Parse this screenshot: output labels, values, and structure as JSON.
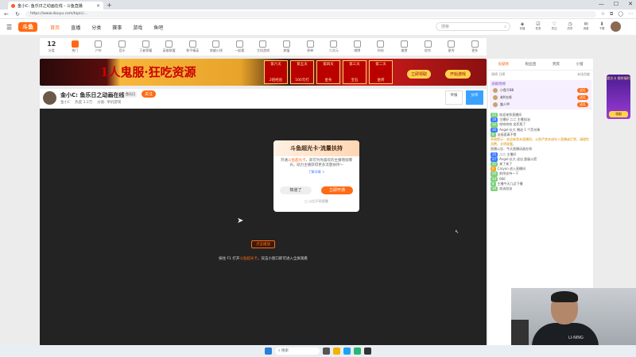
{
  "browser": {
    "tab_title": "金小C: 鱼乐日之动画在线 - 斗鱼直播",
    "new_tab": "+",
    "url": "https://www.douyu.com/topic/..."
  },
  "site": {
    "logo": "斗鱼",
    "nav": [
      "首页",
      "直播",
      "分类",
      "赛事",
      "游戏",
      "鱼吧"
    ],
    "search_placeholder": "搜索",
    "header_icons": [
      {
        "name": "recharge-icon",
        "label": "充值"
      },
      {
        "name": "task-icon",
        "label": "任务"
      },
      {
        "name": "follow-icon",
        "label": "关注"
      },
      {
        "name": "history-icon",
        "label": "历史"
      },
      {
        "name": "message-icon",
        "label": "消息"
      },
      {
        "name": "download-icon",
        "label": "下载"
      },
      {
        "name": "live-icon",
        "label": "开播"
      }
    ]
  },
  "categories": {
    "first_num": "12",
    "first_label": "分类",
    "items": [
      "热门",
      "户外",
      "音乐",
      "王者荣耀",
      "英雄联盟",
      "和平精英",
      "穿越火线",
      "一起看",
      "主机游戏",
      "颜值",
      "原神",
      "二次元",
      "棋牌",
      "科技",
      "美食",
      "综合",
      "星秀",
      "更多"
    ]
  },
  "banner": {
    "headline": "1人鬼服·狂吃资源",
    "boxes": [
      {
        "top": "第六天",
        "bottom": "2倍经验"
      },
      {
        "top": "第五天",
        "bottom": "500元打"
      },
      {
        "top": "第四天",
        "bottom": "金条"
      },
      {
        "top": "第三天",
        "bottom": "宝石"
      },
      {
        "top": "第二天",
        "bottom": "金砖"
      }
    ],
    "btn1": "立即领取",
    "btn2": "开始游戏"
  },
  "room": {
    "title": "金小C: 鱼乐日之动画在线",
    "tag": "鱼乐日",
    "follow": "关注",
    "meta": [
      "金小C",
      "热度 3.2万",
      "分类: 单机游戏"
    ],
    "btn_report": "举报",
    "btn_share": "分享"
  },
  "modal": {
    "title": "斗鱼超光卡·流量扶持",
    "body_prefix": "开通",
    "body_highlight": "斗鱼超光卡",
    "body_rest": "，即可为你喜欢的主播增加曝光，助力主播获得更多流量扶持～",
    "link": "了解详情 >",
    "btn_cancel": "知道了",
    "btn_ok": "立即开通",
    "checkbox": "以后不再提醒"
  },
  "player": {
    "play_label": "点击播放",
    "tip_prefix": "按住 F1 打开",
    "tip_highlight": "斗鱼超光卡",
    "tip_rest": "，双击小窗口即可进入全屏观看"
  },
  "panel": {
    "tabs": [
      "贡献榜",
      "粉丝团",
      "贵宾",
      "小窗"
    ],
    "sub_left": "周榜 日榜",
    "sub_right": "本场贡献",
    "rank_title": "贡献周榜",
    "ranks": [
      {
        "name": "小鱼干88",
        "btn": "送礼"
      },
      {
        "name": "老K在线",
        "btn": "送礼"
      },
      {
        "name": "路人甲",
        "btn": "送礼"
      }
    ],
    "chat": [
      {
        "lv": "23",
        "cls": "",
        "text": "欢迎来到直播间"
      },
      {
        "lv": "18",
        "cls": "b",
        "text": "主播好 二二 主播加油"
      },
      {
        "lv": "12",
        "cls": "",
        "text": "哈哈哈哈 笑死我了"
      },
      {
        "lv": "30",
        "cls": "b",
        "text": "Angel·长大 赠送 1 个荧光棒"
      },
      {
        "lv": "9",
        "cls": "",
        "text": "这画面真不错"
      },
      {
        "lv": "",
        "cls": "sys",
        "text": "系统提示：欢迎来到本直播间，斗鱼严禁未成年人直播或打赏，请理性消费，文明观看。"
      },
      {
        "lv": "",
        "cls": "",
        "text": "直播公告：今天直播动画在线"
      },
      {
        "lv": "15",
        "cls": "b",
        "text": "二二 主播好"
      },
      {
        "lv": "27",
        "cls": "b",
        "text": "Angel·长大 送出 超级火箭"
      },
      {
        "lv": "11",
        "cls": "",
        "text": "来了来了"
      },
      {
        "lv": "6",
        "cls": "o",
        "text": "Caryon 进入直播间"
      },
      {
        "lv": "20",
        "cls": "",
        "text": "前排支持一下"
      },
      {
        "lv": "14",
        "cls": "",
        "text": "666"
      },
      {
        "lv": "8",
        "cls": "",
        "text": "主播今天几点下播"
      },
      {
        "lv": "19",
        "cls": "",
        "text": "加油加油"
      }
    ]
  },
  "floatad": {
    "text": "超光卡 限时福利",
    "btn": "领取"
  },
  "cam": {
    "shirt_logo": "LI-NING"
  },
  "taskbar": {
    "search": "搜索"
  },
  "colors": {
    "accent": "#ff6a13",
    "player_bg": "#232323"
  }
}
